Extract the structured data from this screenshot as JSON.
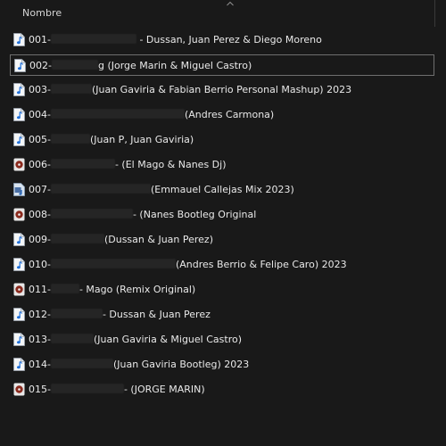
{
  "header": {
    "column_name": "Nombre"
  },
  "files": [
    {
      "num": "001-",
      "title": " - Dussan, Juan Perez & Diego Moreno",
      "icon": "audio-file-icon",
      "selected": false
    },
    {
      "num": "002-",
      "title": "g (Jorge Marin & Miguel Castro)",
      "icon": "audio-file-icon",
      "selected": true
    },
    {
      "num": "003-",
      "title": "(Juan Gaviria & Fabian Berrio Personal Mashup) 2023",
      "icon": "audio-file-icon",
      "selected": false
    },
    {
      "num": "004-",
      "title": "(Andres Carmona)",
      "icon": "audio-file-icon",
      "selected": false
    },
    {
      "num": "005-",
      "title": "(Juan P, Juan Gaviria)",
      "icon": "audio-file-icon",
      "selected": false
    },
    {
      "num": "006-",
      "title": "- (El Mago & Nanes Dj)",
      "icon": "media-disc-icon",
      "selected": false
    },
    {
      "num": "007-",
      "title": "(Emmauel Callejas Mix 2023)",
      "icon": "audio-image-file-icon",
      "selected": false
    },
    {
      "num": "008-",
      "title": "- (Nanes Bootleg Original",
      "icon": "media-disc-icon",
      "selected": false
    },
    {
      "num": "009-",
      "title": "(Dussan & Juan Perez)",
      "icon": "audio-file-icon",
      "selected": false
    },
    {
      "num": "010-",
      "title": "(Andres Berrio & Felipe Caro) 2023",
      "icon": "audio-file-icon",
      "selected": false
    },
    {
      "num": "011-",
      "title": "- Mago (Remix Original)",
      "icon": "media-disc-icon",
      "selected": false
    },
    {
      "num": "012-",
      "title": "- Dussan & Juan Perez",
      "icon": "audio-file-icon",
      "selected": false
    },
    {
      "num": "013-",
      "title": "(Juan Gaviria & Miguel Castro)",
      "icon": "audio-file-icon",
      "selected": false
    },
    {
      "num": "014-",
      "title": "(Juan Gaviria Bootleg) 2023",
      "icon": "audio-file-icon",
      "selected": false
    },
    {
      "num": "015-",
      "title": "- (JORGE MARIN)",
      "icon": "media-disc-icon",
      "selected": false
    }
  ],
  "colors": {
    "background": "#191919",
    "text": "#e9e9e9",
    "selection_border": "#6f6f6f"
  }
}
